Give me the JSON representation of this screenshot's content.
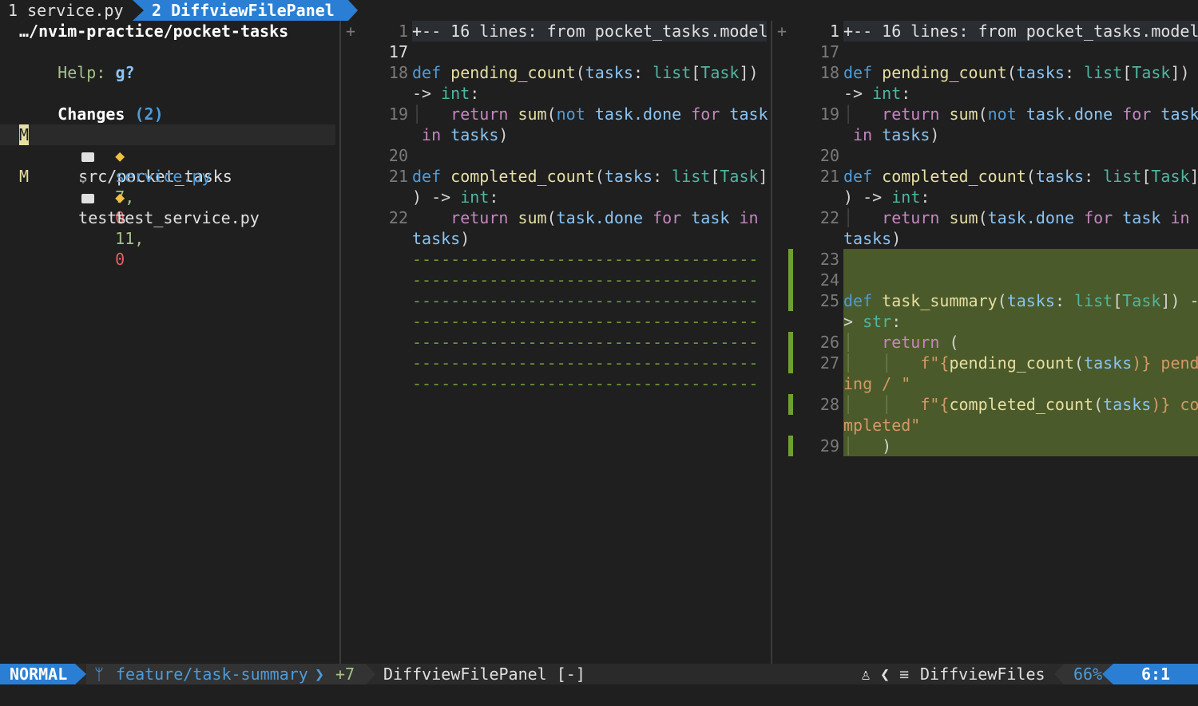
{
  "tabline": {
    "tab1": "1 service.py ",
    "tab2": " 2 DiffviewFilePanel "
  },
  "panel": {
    "path": "…/nvim-practice/pocket-tasks",
    "help_label": "Help:",
    "help_key": "g?",
    "changes_label": "Changes",
    "changes_count": "(2)",
    "folders": [
      {
        "name": "src/pocket_tasks"
      },
      {
        "name": "tests"
      }
    ],
    "files": [
      {
        "status": "M",
        "name": "service.py",
        "added": "7,",
        "removed": "0"
      },
      {
        "status": "M",
        "name": "test_service.py",
        "added": "11,",
        "removed": "0"
      }
    ]
  },
  "diff": {
    "fold_marker": "+",
    "fold_text": "+-- 16 lines: from pocket_tasks.model",
    "line_numbers_left": [
      "1",
      "17",
      "18",
      "19",
      "20",
      "21",
      "22"
    ],
    "line_numbers_right": [
      "1",
      "17",
      "18",
      "19",
      "20",
      "21",
      "22",
      "23",
      "24",
      "25",
      "26",
      "27",
      "28",
      "29"
    ],
    "filler": "------------------------------------",
    "code": {
      "def": "def",
      "pending_count": "pending_count",
      "completed_count": "completed_count",
      "task_summary": "task_summary",
      "tasks_param": "tasks",
      "list": "list",
      "Task": "Task",
      "int": "int",
      "str": "str",
      "return": "return",
      "sum": "sum",
      "not": "not",
      "task_done": "task.done",
      "for": "for",
      "task": "task",
      "in": "in",
      "arrow": "->",
      "tasks": "tasks",
      "fstring1a": "f\"{",
      "fstring1b": "pending_count",
      "fstring1c": "(",
      "fstring1d": "tasks",
      "fstring1e": ")} pend",
      "fstring1f": "ing / \"",
      "fstring2b": "completed_count",
      "fstring2e": ")} co",
      "fstring2f": "mpleted\""
    }
  },
  "statusline": {
    "mode": "NORMAL",
    "branch_icon": "git-branch-icon",
    "branch": "feature/task-summary",
    "diff_added": "+7",
    "filename": "DiffviewFilePanel [-]",
    "filetype": "DiffviewFiles",
    "percent": "66%",
    "position": "6:1"
  },
  "colors": {
    "accent": "#2a7fd4",
    "added_bg": "#4b5a2a",
    "fold_bg": "#2a2d32"
  }
}
